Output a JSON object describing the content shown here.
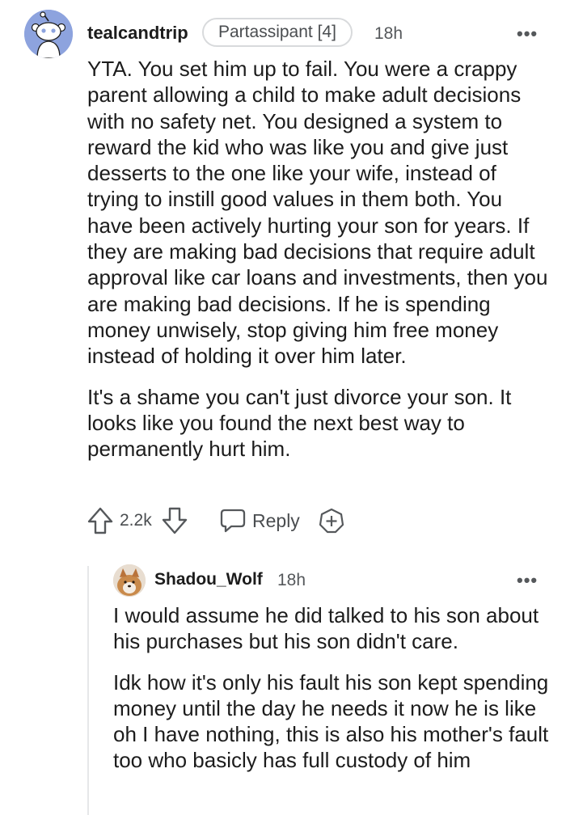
{
  "comment": {
    "username": "tealcandtrip",
    "flair": "Partassipant [4]",
    "time": "18h",
    "more": "•••",
    "paragraphs": [
      "YTA. You set him up to fail. You were a crappy parent allowing a child to make adult decisions with no safety net. You designed a system to reward the kid who was like you and give just desserts to the one like your wife, instead of trying to instill good values in them both. You have been actively hurting your son for years. If they are making bad decisions that require adult approval like car loans and investments, then you are making bad decisions. If he is spending money unwisely, stop giving him free money instead of holding it over him later.",
      "It's a shame you can't just divorce your son. It looks like you found the next best way to permanently hurt him."
    ],
    "votes": "2.2k",
    "reply_label": "Reply"
  },
  "reply": {
    "username": "Shadou_Wolf",
    "time": "18h",
    "more": "•••",
    "paragraphs": [
      "I would assume he did talked to his son about his purchases but his son didn't care.",
      "Idk how it's only his fault his son kept spending money until the day he needs it now he is like oh I have nothing, this is also his mother's fault too who basicly has full custody of him"
    ]
  },
  "colors": {
    "avatar_bg": "#8da3de",
    "text": "#1c1c1c",
    "meta": "#55585b",
    "thread_line": "#e6e7e9"
  }
}
